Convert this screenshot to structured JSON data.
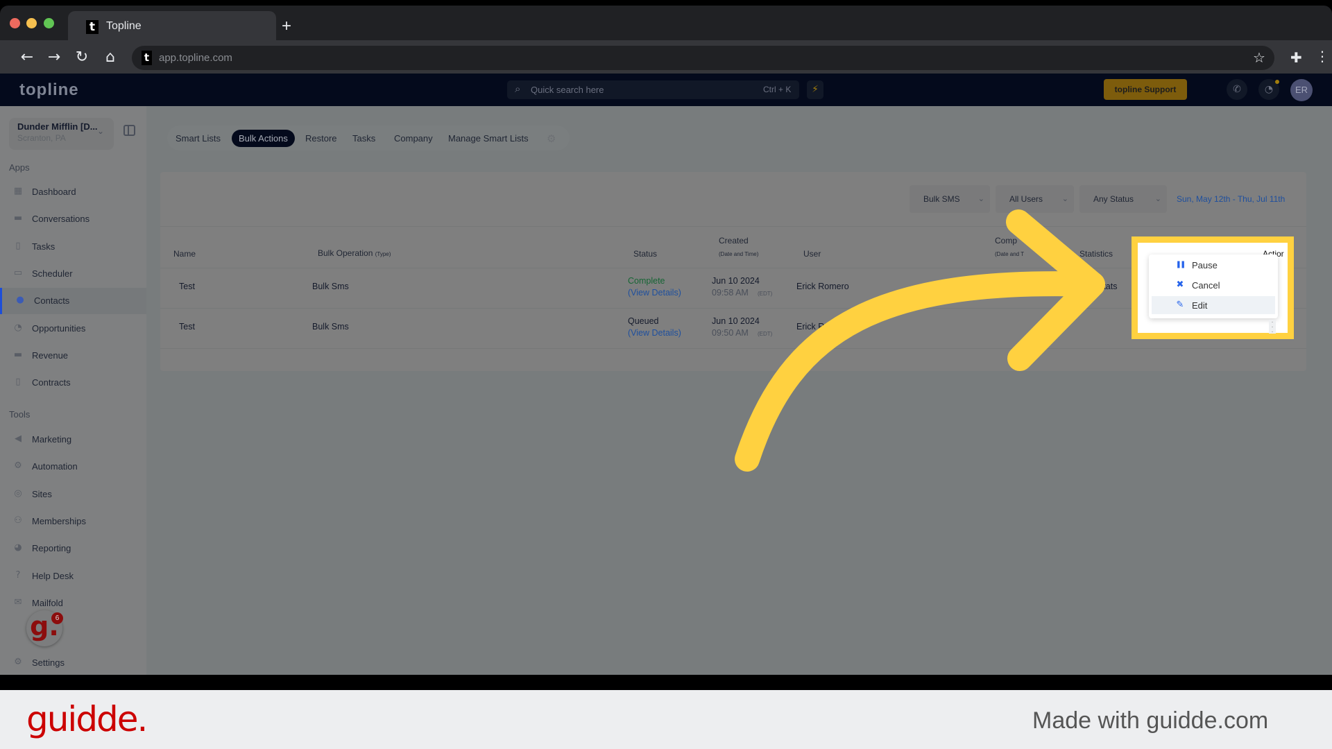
{
  "browser": {
    "tab_title": "Topline",
    "tab_favicon": "t",
    "new_tab": "+",
    "url": "app.topline.com",
    "nav": {
      "back": "←",
      "forward": "→",
      "reload": "↻",
      "home": "⌂"
    },
    "star_icon": "☆",
    "extensions_icon": "✚",
    "menu_icon": "⋮",
    "traffic_colors": [
      "#ed6a5e",
      "#f5bf4f",
      "#61c554"
    ]
  },
  "header": {
    "logo": "topline",
    "search_placeholder": "Quick search here",
    "search_shortcut": "Ctrl + K",
    "bolt_icon": "⚡",
    "support_label": "topline Support",
    "phone_icon": "✆",
    "bell_icon": "🔔",
    "avatar_initials": "ER"
  },
  "sidebar": {
    "location_name": "Dunder Mifflin [D...",
    "location_sub": "Scranton, PA",
    "apps_label": "Apps",
    "apps": [
      {
        "label": "Dashboard",
        "icon": "▦"
      },
      {
        "label": "Conversations",
        "icon": "▬"
      },
      {
        "label": "Tasks",
        "icon": "▯"
      },
      {
        "label": "Scheduler",
        "icon": "▭"
      },
      {
        "label": "Contacts",
        "icon": "●",
        "active": true
      },
      {
        "label": "Opportunities",
        "icon": "◔"
      },
      {
        "label": "Revenue",
        "icon": "▬"
      },
      {
        "label": "Contracts",
        "icon": "▯"
      }
    ],
    "tools_label": "Tools",
    "tools": [
      {
        "label": "Marketing",
        "icon": "◀"
      },
      {
        "label": "Automation",
        "icon": "⚙"
      },
      {
        "label": "Sites",
        "icon": "◎"
      },
      {
        "label": "Memberships",
        "icon": "⚇"
      },
      {
        "label": "Reporting",
        "icon": "◕"
      },
      {
        "label": "Help Desk",
        "icon": "?"
      },
      {
        "label": "Mailfold",
        "icon": "✉"
      }
    ],
    "settings_label": "Settings",
    "settings_icon": "⚙",
    "guidde_badge": "g.",
    "guidde_count": "6"
  },
  "tabs": [
    {
      "label": "Smart Lists"
    },
    {
      "label": "Bulk Actions",
      "active": true
    },
    {
      "label": "Restore"
    },
    {
      "label": "Tasks"
    },
    {
      "label": "Company"
    },
    {
      "label": "Manage Smart Lists"
    }
  ],
  "tab_settings_icon": "⚙",
  "filters": {
    "type": "Bulk SMS",
    "users": "All Users",
    "status": "Any Status",
    "date_range": "Sun, May 12th - Thu, Jul 11th",
    "chevron": "⌄"
  },
  "table": {
    "headers": {
      "name": "Name",
      "operation": "Bulk Operation",
      "operation_sub": "(Type)",
      "status": "Status",
      "created": "Created",
      "created_sub": "(Date and Time)",
      "user": "User",
      "completed": "Comp",
      "completed_sub": "(Date and T",
      "statistics": "Statistics",
      "action": "Actior"
    },
    "rows": [
      {
        "name": "Test",
        "operation": "Bulk Sms",
        "status": "Complete",
        "details": "(View Details)",
        "date": "Jun 10 2024",
        "time": "09:58 AM",
        "tz": "(EDT)",
        "user": "Erick Romero",
        "stats": "Stats"
      },
      {
        "name": "Test",
        "operation": "Bulk Sms",
        "status": "Queued",
        "details": "(View Details)",
        "date": "Jun 10 2024",
        "time": "09:50 AM",
        "tz": "(EDT)",
        "user": "Erick R",
        "stats": ""
      }
    ]
  },
  "action_menu": {
    "items": [
      {
        "label": "Pause",
        "icon": "❚❚"
      },
      {
        "label": "Cancel",
        "icon": "✖"
      },
      {
        "label": "Edit",
        "icon": "✎",
        "highlighted": true
      }
    ],
    "row_menu_icon": "⋮"
  },
  "annotation": {
    "color": "#ffd140"
  },
  "footer": {
    "brand": "guidde.",
    "tagline": "Made with guidde.com"
  }
}
